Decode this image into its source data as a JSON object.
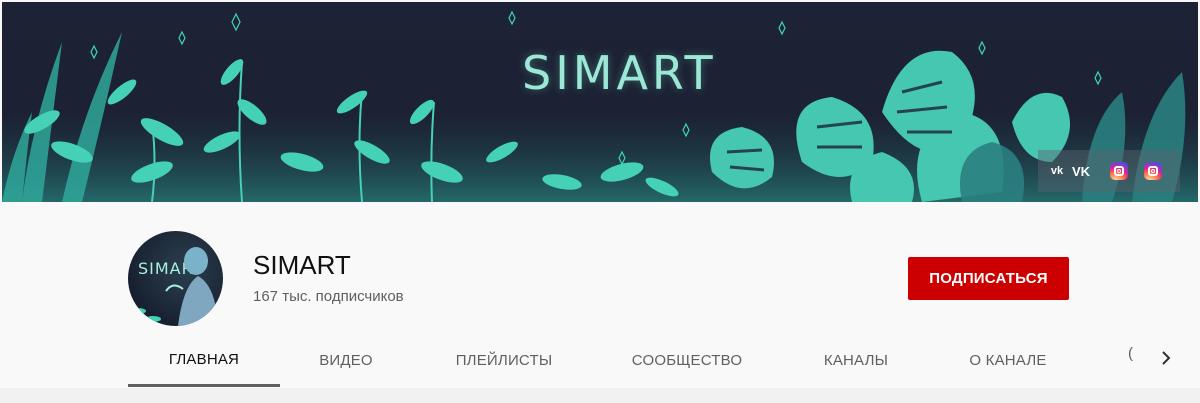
{
  "banner": {
    "title": "SIMART",
    "social": {
      "vk_label": "VK",
      "vk_icon": "vk-icon",
      "instagram_icons": [
        "instagram-icon",
        "instagram-icon"
      ]
    }
  },
  "channel": {
    "avatar_text": "SIMART",
    "name": "SIMART",
    "subscribers": "167 тыс. подписчиков",
    "subscribe_label": "ПОДПИСАТЬСЯ"
  },
  "tabs": [
    {
      "label": "ГЛАВНАЯ",
      "active": true
    },
    {
      "label": "ВИДЕО",
      "active": false
    },
    {
      "label": "ПЛЕЙЛИСТЫ",
      "active": false
    },
    {
      "label": "СООБЩЕСТВО",
      "active": false
    },
    {
      "label": "КАНАЛЫ",
      "active": false
    },
    {
      "label": "О КАНАЛЕ",
      "active": false
    }
  ],
  "tab_overflow_glyph": "(",
  "colors": {
    "subscribe": "#cc0000",
    "banner_bg": "#1d2336",
    "leaf_teal": "#3fd6b4",
    "leaf_dark": "#1f8f8a"
  }
}
